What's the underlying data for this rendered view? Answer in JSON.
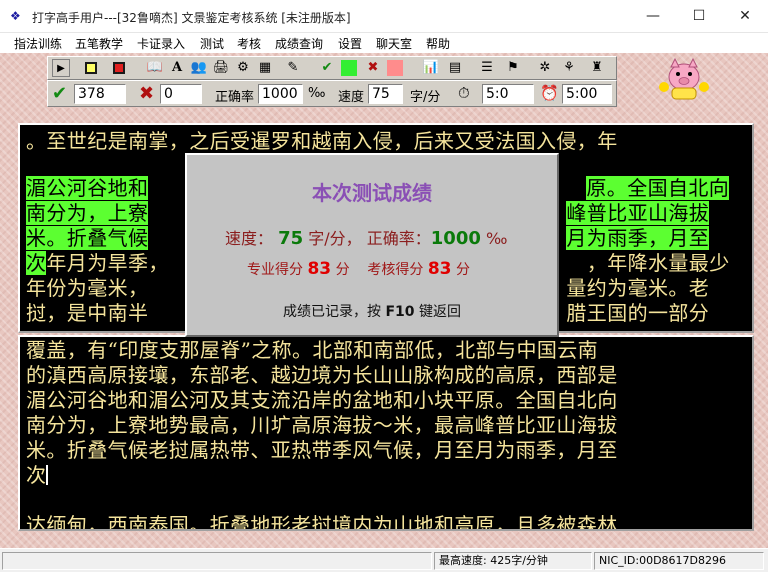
{
  "window": {
    "title": "打字高手用户---[32鲁嘀杰]    文景鉴定考核系统  [未注册版本]",
    "minimize": "—",
    "maximize": "☐",
    "close": "✕"
  },
  "menu": [
    "指法训练",
    "五笔教学",
    "卡证录入",
    "测试",
    "考核",
    "成绩查询",
    "设置",
    "聊天室",
    "帮助"
  ],
  "stats": {
    "correct_count": "378",
    "wrong_count": "0",
    "accuracy_label": "正确率",
    "accuracy_value": "1000",
    "accuracy_unit": "‰",
    "speed_label": "速度",
    "speed_value": "75",
    "speed_unit": "字/分",
    "elapsed": "5:0",
    "time_limit": "5:00"
  },
  "colors": {
    "text": "#f5e49c",
    "highlight": "#5cff31",
    "dialog_title": "#8a4fb5"
  },
  "source_text": {
    "line1": "。至世纪是南掌，之后受暹罗和越南入侵，后来又受法国入侵，年",
    "line2a": "湄公河谷地和",
    "line2b": "原。全国自北向",
    "line3a": "南分为，上寮",
    "line3b": "峰普比亚山海拔",
    "line4a": "米。折叠气候",
    "line4b": "月为雨季，月至",
    "line5a_hl": "次",
    "line5a": "年月为旱季，",
    "line5b": "，年降水量最少",
    "line6a": "年份为毫米，",
    "line6b": "量约为毫米。老",
    "line7a": "挝，是中南半",
    "line7b": "腊王国的一部分"
  },
  "typed_text": {
    "line1": "覆盖，有“印度支那屋脊”之称。北部和南部低，北部与中国云南",
    "line2": "的滇西高原接壤，东部老、越边境为长山山脉构成的高原，西部是",
    "line3": "湄公河谷地和湄公河及其支流沿岸的盆地和小块平原。全国自北向",
    "line4": "南分为，上寮地势最高，川圹高原海拔～米，最高峰普比亚山海拔",
    "line5": "米。折叠气候老挝属热带、亚热带季风气候，月至月为雨季，月至",
    "line6": "次",
    "line8": "达缅甸，西南泰国。折叠地形老挝境内为山地和高原，且多被森林"
  },
  "result_dialog": {
    "title": "本次测试成绩",
    "speed_label": "速度：",
    "speed_value": "75",
    "speed_unit": "字/分，",
    "accuracy_label": "正确率：",
    "accuracy_value": "1000",
    "accuracy_unit": "‰",
    "pro_label": "专业得分",
    "pro_score": "83",
    "pro_unit": "分",
    "exam_label": "考核得分",
    "exam_score": "83",
    "exam_unit": "分",
    "footer_before": "成绩已记录，按",
    "footer_key": "F10",
    "footer_after": "键返回"
  },
  "statusbar": {
    "max_speed": "最高速度:  425字/分钟",
    "nic_id": "NIC_ID:00D8617D8296"
  },
  "icons": {
    "app": "paw-icon",
    "play": "play-icon",
    "stop": "stop-icon",
    "record": "record-icon",
    "check": "check-icon",
    "cross": "cross-icon",
    "timer": "stopwatch-icon",
    "alarm": "alarm-clock-icon",
    "mascot": "pig-mascot-icon"
  }
}
